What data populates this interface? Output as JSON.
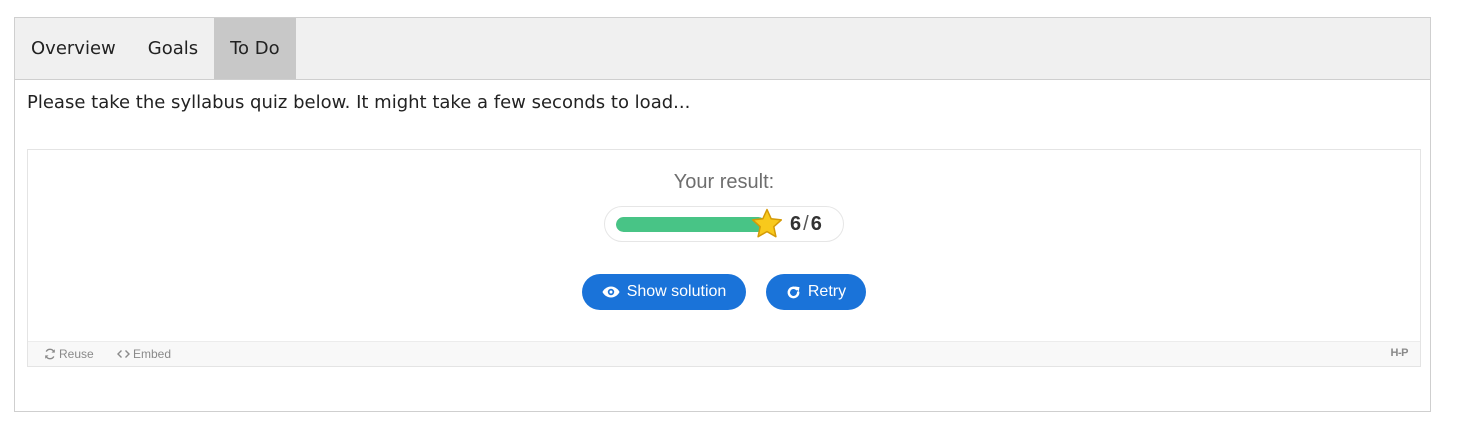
{
  "tabs": [
    {
      "label": "Overview",
      "active": false
    },
    {
      "label": "Goals",
      "active": false
    },
    {
      "label": "To Do",
      "active": true
    }
  ],
  "intro_text": "Please take the syllabus quiz below. It might take a few seconds to load...",
  "quiz": {
    "result_label": "Your result:",
    "score": "6",
    "score_separator": "/",
    "max_score": "6",
    "progress_fraction": 1.0,
    "show_solution_label": "Show solution",
    "retry_label": "Retry"
  },
  "footer": {
    "reuse_label": "Reuse",
    "embed_label": "Embed",
    "logo_text": "H-P"
  },
  "colors": {
    "accent": "#1a73d9",
    "progress": "#48c486",
    "star": "#f8c91c"
  },
  "icons": {
    "show_solution": "eye-icon",
    "retry": "retry-icon",
    "reuse": "refresh-icon",
    "embed": "code-icon",
    "result": "star-icon"
  }
}
